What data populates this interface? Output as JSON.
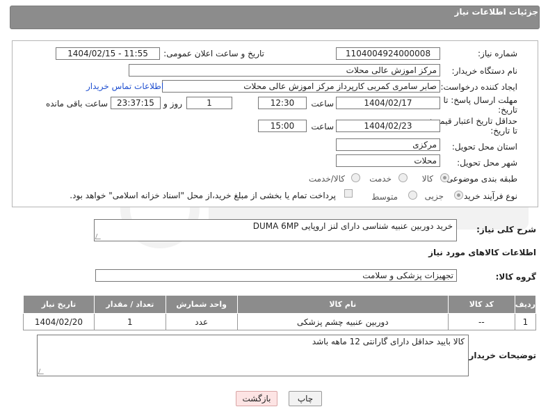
{
  "header": {
    "title": "جزئیات اطلاعات نیاز"
  },
  "form": {
    "need_number_label": "شماره نیاز:",
    "need_number": "1104004924000008",
    "announce_label": "تاریخ و ساعت اعلان عمومی:",
    "announce_value": "1404/02/15 - 11:55",
    "buyer_org_label": "نام دستگاه خریدار:",
    "buyer_org": "مرکز اموزش عالی محلات",
    "creator_label": "ایجاد کننده درخواست:",
    "creator": "صابر  سامری کمربی کارپرداز مرکز اموزش عالی محلات",
    "contact_link": "اطلاعات تماس خریدار",
    "deadline_label_1": "مهلت ارسال پاسخ: تا",
    "deadline_label_2": "تاریخ:",
    "deadline_date": "1404/02/17",
    "time_label": "ساعت",
    "deadline_time": "12:30",
    "days_value": "1",
    "days_label": "روز و",
    "remaining_time": "23:37:15",
    "remaining_label": "ساعت باقی مانده",
    "validity_label_1": "حداقل تاریخ اعتبار قیمت:",
    "validity_label_2": "تا تاریخ:",
    "validity_date": "1404/02/23",
    "validity_time_label": "ساعت",
    "validity_time": "15:00",
    "province_label": "استان محل تحویل:",
    "province": "مرکزی",
    "city_label": "شهر محل تحویل:",
    "city": "محلات",
    "category_label": "طبقه بندی موضوعی:",
    "category_options": [
      "کالا",
      "خدمت",
      "کالا/خدمت"
    ],
    "process_label": "نوع فرآیند خرید :",
    "process_options": [
      "جزیی",
      "متوسط"
    ],
    "payment_note": "پرداخت تمام یا بخشی از مبلغ خرید،از محل \"اسناد خزانه اسلامی\" خواهد بود."
  },
  "description": {
    "label": "شرح کلی نیاز:",
    "value": "خرید دوربین عنبیه شناسی دارای لنز اروپایی DUMA 6MP"
  },
  "goods_section": {
    "title": "اطلاعات کالاهای مورد نیاز"
  },
  "goods_group": {
    "label": "گروه کالا:",
    "value": "تجهیزات پزشکی و سلامت"
  },
  "table": {
    "headers": [
      "ردیف",
      "کد کالا",
      "نام کالا",
      "واحد شمارش",
      "تعداد / مقدار",
      "تاریخ نیاز"
    ],
    "rows": [
      [
        "1",
        "--",
        "دوربین عنبیه چشم پزشکی",
        "عدد",
        "1",
        "1404/02/20"
      ]
    ]
  },
  "buyer_notes": {
    "label": "توضیحات خریدار:",
    "value": "کالا بایید حداقل دارای گارانتی 12 ماهه باشد"
  },
  "buttons": {
    "print": "چاپ",
    "back": "بازگشت"
  },
  "colors": {
    "header_bg": "#8c8c8c",
    "link": "#1f4fd0",
    "back_button_bg": "#fde4e4"
  }
}
